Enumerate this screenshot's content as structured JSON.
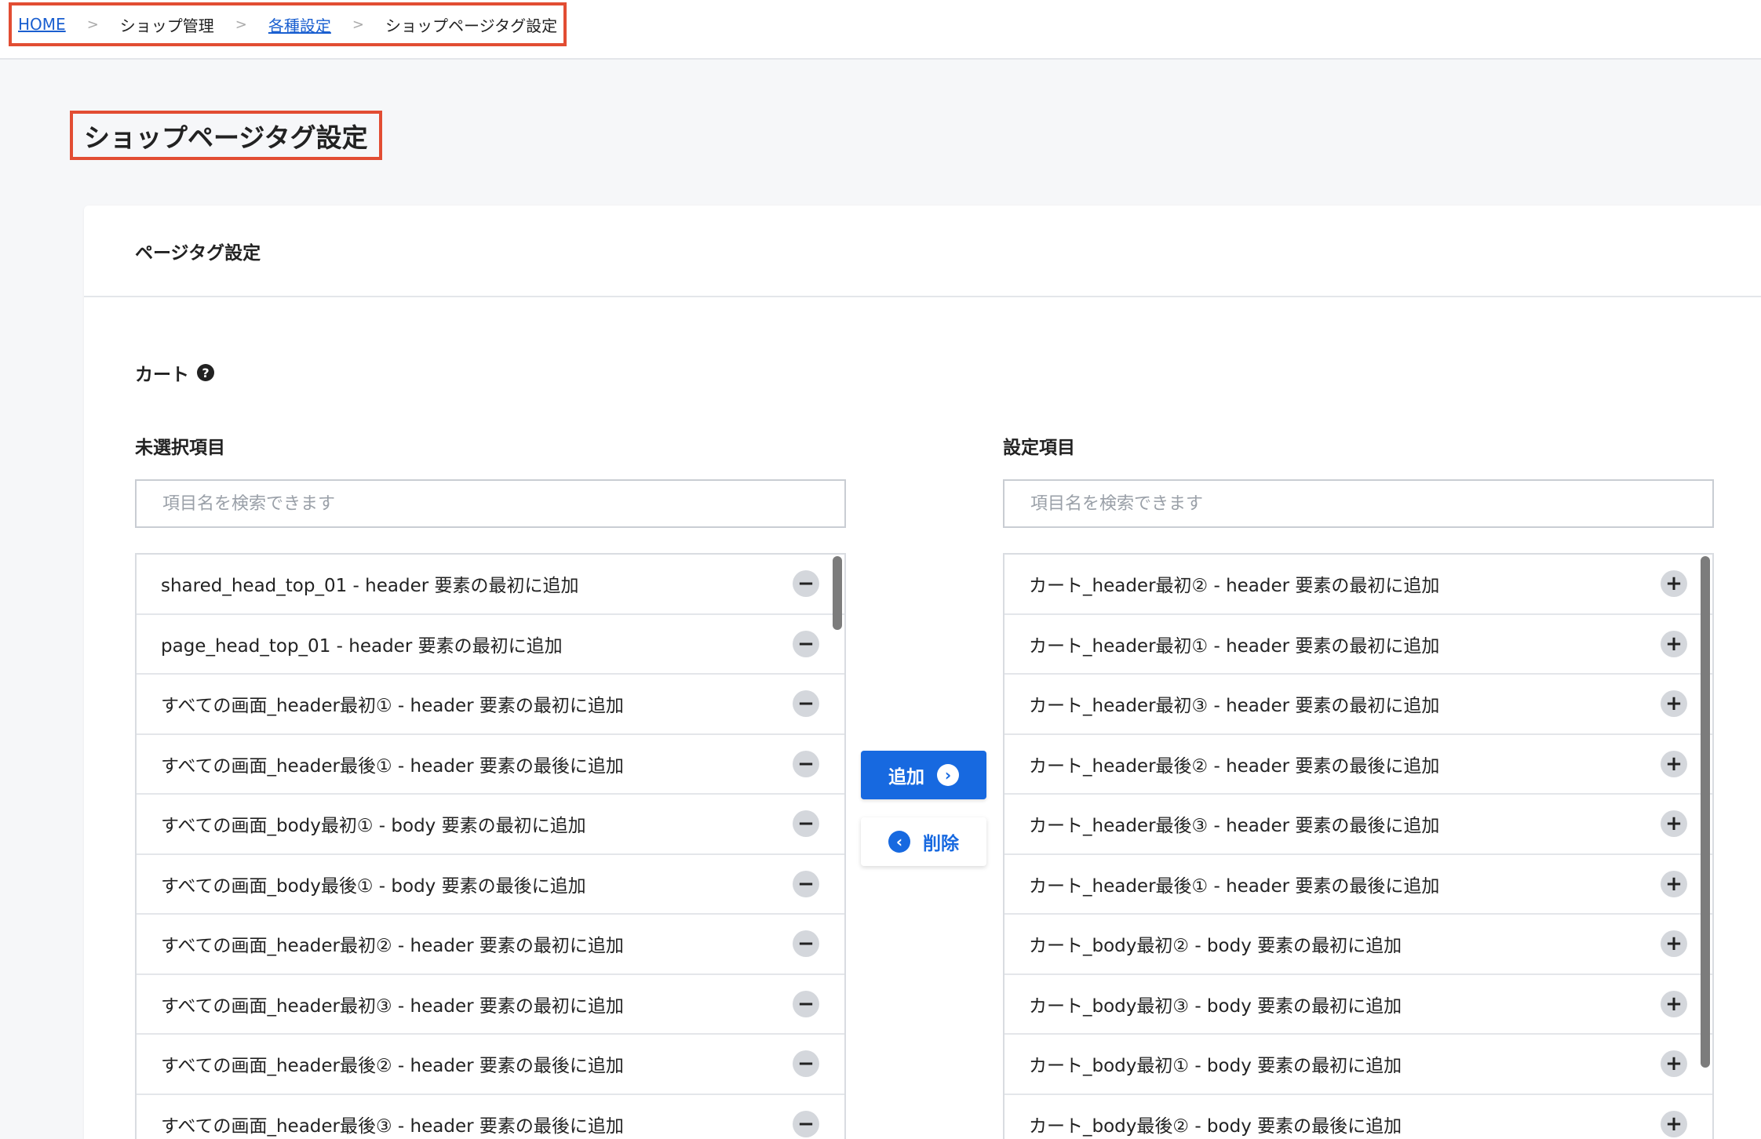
{
  "breadcrumb": {
    "home": "HOME",
    "shop_admin": "ショップ管理",
    "settings": "各種設定",
    "current": "ショップページタグ設定",
    "separator": ">"
  },
  "page": {
    "title": "ショップページタグ設定"
  },
  "card": {
    "title": "ページタグ設定"
  },
  "section": {
    "label": "カート",
    "help_icon": "question-circle-icon"
  },
  "left": {
    "title": "未選択項目",
    "placeholder": "項目名を検索できます",
    "items": [
      "shared_head_top_01 - header 要素の最初に追加",
      "page_head_top_01 - header 要素の最初に追加",
      "すべての画面_header最初① - header 要素の最初に追加",
      "すべての画面_header最後① - header 要素の最後に追加",
      "すべての画面_body最初① - body 要素の最初に追加",
      "すべての画面_body最後① - body 要素の最後に追加",
      "すべての画面_header最初② - header 要素の最初に追加",
      "すべての画面_header最初③ - header 要素の最初に追加",
      "すべての画面_header最後② - header 要素の最後に追加",
      "すべての画面_header最後③ - header 要素の最後に追加"
    ]
  },
  "right": {
    "title": "設定項目",
    "placeholder": "項目名を検索できます",
    "items": [
      "カート_header最初② - header 要素の最初に追加",
      "カート_header最初① - header 要素の最初に追加",
      "カート_header最初③ - header 要素の最初に追加",
      "カート_header最後② - header 要素の最後に追加",
      "カート_header最後③ - header 要素の最後に追加",
      "カート_header最後① - header 要素の最後に追加",
      "カート_body最初② - body 要素の最初に追加",
      "カート_body最初③ - body 要素の最初に追加",
      "カート_body最初① - body 要素の最初に追加",
      "カート_body最後② - body 要素の最後に追加"
    ]
  },
  "buttons": {
    "add": "追加",
    "remove": "削除"
  },
  "colors": {
    "accent": "#1769e0",
    "highlight_border": "#e24d33"
  }
}
